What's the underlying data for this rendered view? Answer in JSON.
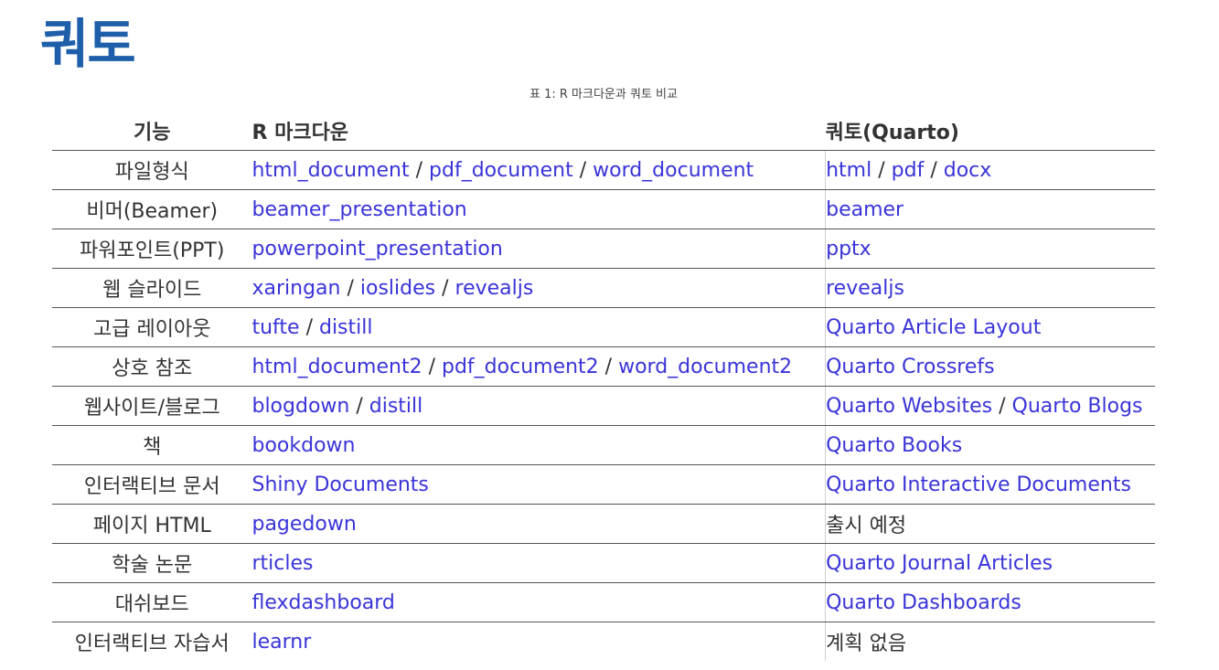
{
  "title": "쿼토",
  "caption": "표 1: R 마크다운과 쿼토 비교",
  "headers": {
    "feature": "기능",
    "rmarkdown": "R 마크다운",
    "quarto": "쿼토(Quarto)"
  },
  "separator": " / ",
  "rows": [
    {
      "feature": "파일형식",
      "rmarkdown": [
        "html_document",
        "pdf_document",
        "word_document"
      ],
      "quarto": [
        "html",
        "pdf",
        "docx"
      ],
      "quarto_plain": false
    },
    {
      "feature": "비머(Beamer)",
      "rmarkdown": [
        "beamer_presentation"
      ],
      "quarto": [
        "beamer"
      ],
      "quarto_plain": false
    },
    {
      "feature": "파워포인트(PPT)",
      "rmarkdown": [
        "powerpoint_presentation"
      ],
      "quarto": [
        "pptx"
      ],
      "quarto_plain": false
    },
    {
      "feature": "웹 슬라이드",
      "rmarkdown": [
        "xaringan",
        "ioslides",
        "revealjs"
      ],
      "quarto": [
        "revealjs"
      ],
      "quarto_plain": false
    },
    {
      "feature": "고급 레이아웃",
      "rmarkdown": [
        "tufte",
        "distill"
      ],
      "quarto": [
        "Quarto Article Layout"
      ],
      "quarto_plain": false
    },
    {
      "feature": "상호 참조",
      "rmarkdown": [
        "html_document2",
        "pdf_document2",
        "word_document2"
      ],
      "quarto": [
        "Quarto Crossrefs"
      ],
      "quarto_plain": false
    },
    {
      "feature": "웹사이트/블로그",
      "rmarkdown": [
        "blogdown",
        "distill"
      ],
      "quarto": [
        "Quarto Websites",
        "Quarto Blogs"
      ],
      "quarto_plain": false
    },
    {
      "feature": "책",
      "rmarkdown": [
        "bookdown"
      ],
      "quarto": [
        "Quarto Books"
      ],
      "quarto_plain": false
    },
    {
      "feature": "인터랙티브 문서",
      "rmarkdown": [
        "Shiny Documents"
      ],
      "quarto": [
        "Quarto Interactive Documents"
      ],
      "quarto_plain": false
    },
    {
      "feature": "페이지 HTML",
      "rmarkdown": [
        "pagedown"
      ],
      "quarto": [
        "출시 예정"
      ],
      "quarto_plain": true
    },
    {
      "feature": "학술 논문",
      "rmarkdown": [
        "rticles"
      ],
      "quarto": [
        "Quarto Journal Articles"
      ],
      "quarto_plain": false
    },
    {
      "feature": "대쉬보드",
      "rmarkdown": [
        "flexdashboard"
      ],
      "quarto": [
        "Quarto Dashboards"
      ],
      "quarto_plain": false
    },
    {
      "feature": "인터랙티브 자습서",
      "rmarkdown": [
        "learnr"
      ],
      "quarto": [
        "계획 없음"
      ],
      "quarto_plain": true
    }
  ],
  "colors": {
    "title": "#1f5faa",
    "link": "#3a34d8",
    "text": "#333333"
  }
}
